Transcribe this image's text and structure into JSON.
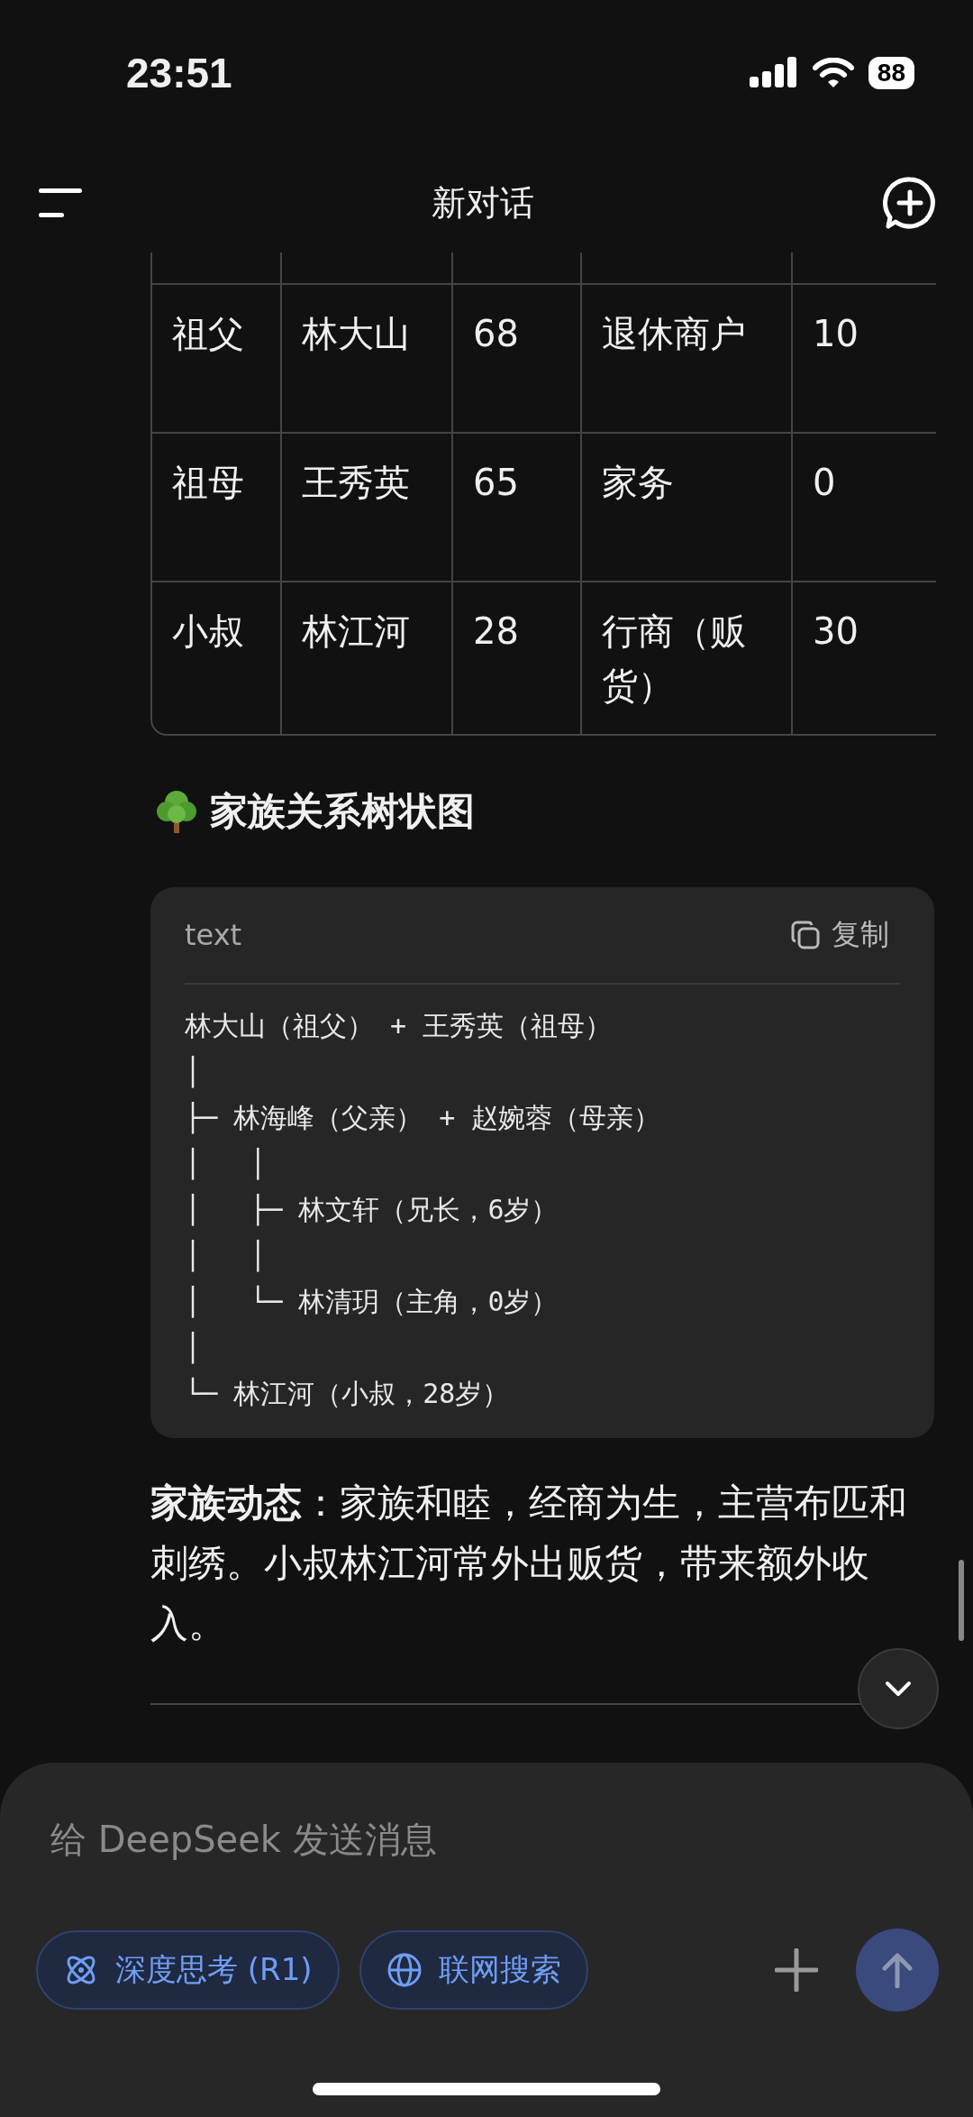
{
  "status_bar": {
    "time": "23:51",
    "battery": "88"
  },
  "header": {
    "title": "新对话"
  },
  "table": {
    "rows": [
      [
        "祖父",
        "林大山",
        "68",
        "退休商户",
        "10"
      ],
      [
        "祖母",
        "王秀英",
        "65",
        "家务",
        "0"
      ],
      [
        "小叔",
        "林江河",
        "28",
        "行商（贩货）",
        "30"
      ]
    ]
  },
  "section_heading": "家族关系树状图",
  "code_block": {
    "language": "text",
    "copy_label": "复制",
    "lines": [
      "林大山（祖父） + 王秀英（祖母）",
      "│",
      "├─ 林海峰（父亲） + 赵婉蓉（母亲）",
      "│   │",
      "│   ├─ 林文轩（兄长，6岁）",
      "│   │",
      "│   └─ 林清玥（主角，0岁）",
      "│",
      "└─ 林江河（小叔，28岁）"
    ]
  },
  "paragraph": "**家族动态**：家族和睦，经商为生，主营布匹和刺绣。小叔林江河常外出贩货，带来额外收入。",
  "composer": {
    "placeholder": "给 DeepSeek 发送消息",
    "toggles": [
      {
        "kind": "deep-think",
        "label": "深度思考 (R1)",
        "selected": true
      },
      {
        "kind": "web-search",
        "label": "联网搜索",
        "selected": true
      }
    ]
  }
}
